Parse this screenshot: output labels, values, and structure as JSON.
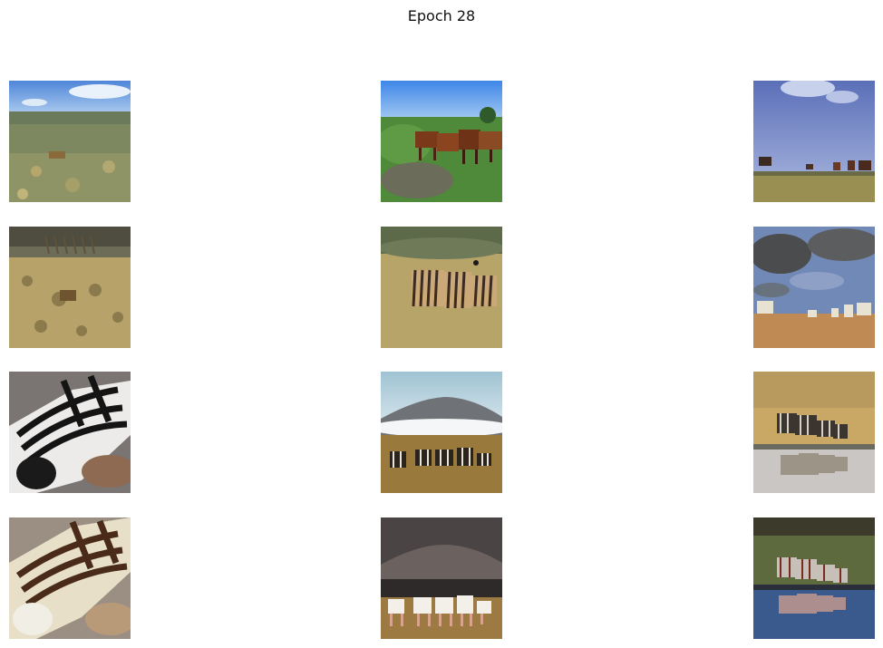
{
  "figure": {
    "title": "Epoch 28"
  }
}
